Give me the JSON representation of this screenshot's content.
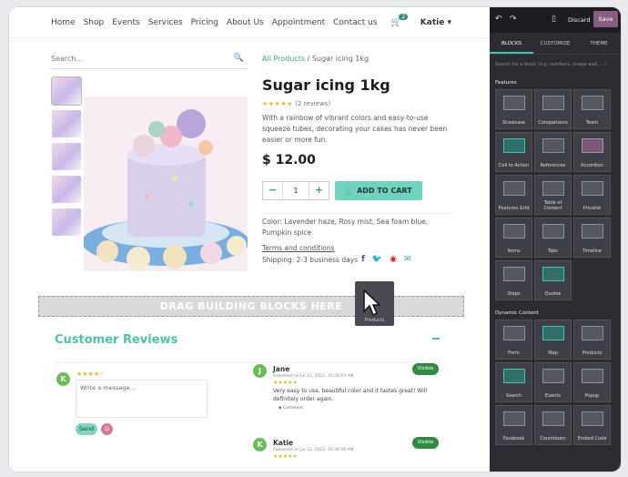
{
  "nav": {
    "links": [
      "Home",
      "Shop",
      "Events",
      "Services",
      "Pricing",
      "About Us",
      "Appointment",
      "Contact us"
    ],
    "cart_count": "2",
    "user": "Katie"
  },
  "search": {
    "placeholder": "Search..."
  },
  "breadcrumb": {
    "link": "All Products",
    "separator": "/",
    "current": "Sugar icing 1kg"
  },
  "product": {
    "title": "Sugar icing 1kg",
    "stars": "★★★★★",
    "reviews": "(2 reviews)",
    "description": "With a rainbow of vibrant colors and easy-to-use squeeze tubes, decorating your cakes has never been easier or more fun.",
    "price": "$ 12.00",
    "qty_minus": "−",
    "quantity": "1",
    "qty_plus": "+",
    "add_to_cart": "ADD TO CART",
    "colors": "Color: Lavender haze, Rosy mist, Sea foam blue, Pumpkin spice",
    "terms": "Terms and conditions",
    "shipping": "Shipping: 2-3 business days"
  },
  "social": {
    "facebook": "f",
    "twitter": "🐦",
    "pinterest": "◉",
    "email": "✉"
  },
  "dropzone": {
    "label": "DRAG BUILDING BLOCKS HERE",
    "drag_card_label": "Products"
  },
  "reviews": {
    "title": "Customer Reviews",
    "my_avatar": "K",
    "my_stars": "★★★★☆",
    "message_placeholder": "Write a message...",
    "send": "Send",
    "emoji": "☺",
    "items": [
      {
        "avatar": "J",
        "name": "Jane",
        "date": "Published on Jul 12, 2023, 10:34:03 AM",
        "stars": "★★★★★",
        "text": "Very easy to use, beautiful color and it tastes great! Will definitely order again.",
        "comment": "◆ Comment",
        "badge": "Visible"
      },
      {
        "avatar": "K",
        "name": "Katie",
        "date": "Published on Jul 12, 2023, 10:36:09 AM",
        "stars": "★★★★★",
        "badge": "Visible"
      }
    ]
  },
  "editor": {
    "undo": "↶",
    "redo": "↷",
    "mobile": "▯",
    "discard": "Discard",
    "save": "Save",
    "tabs": [
      "BLOCKS",
      "CUSTOMIZE",
      "THEME"
    ],
    "search_placeholder": "Search for a block (e.g. numbers, image wall, ...)",
    "sections": {
      "features": {
        "title": "Features",
        "blocks": [
          "Showcase",
          "Comparisons",
          "Team",
          "Call to Action",
          "References",
          "Accordion",
          "Features Grid",
          "Table of Content",
          "Pricelist",
          "Items",
          "Tabs",
          "Timeline",
          "Steps",
          "Quotes"
        ]
      },
      "dynamic": {
        "title": "Dynamic Content",
        "blocks": [
          "Form",
          "Map",
          "Products",
          "Search",
          "Events",
          "Popup",
          "Facebook",
          "Countdown",
          "Embed Code"
        ]
      }
    }
  }
}
